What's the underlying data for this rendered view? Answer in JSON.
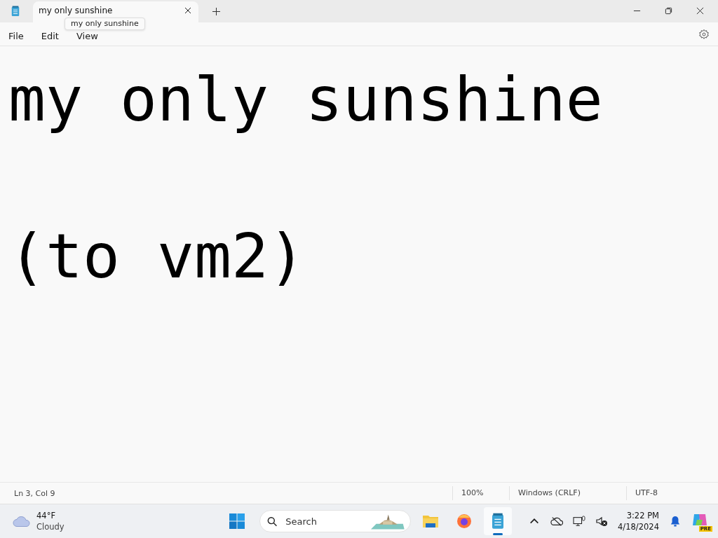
{
  "tabs": [
    {
      "label": "my only sunshine",
      "selected": true
    }
  ],
  "tooltip": "my only sunshine",
  "menu": [
    "File",
    "Edit",
    "View"
  ],
  "editor": {
    "lines": [
      "my only sunshine",
      "(to vm2)"
    ]
  },
  "status_bar": {
    "position": "Ln 3, Col 9",
    "zoom": "100%",
    "line_ending": "Windows (CRLF)",
    "encoding": "UTF-8"
  },
  "taskbar": {
    "weather": {
      "temperature": "44°F",
      "condition": "Cloudy"
    },
    "search": {
      "placeholder": "Search"
    },
    "apps": [
      {
        "kind": "files",
        "selected": false
      },
      {
        "kind": "browser",
        "selected": false
      },
      {
        "kind": "notepad",
        "selected": true
      }
    ],
    "time": "3:22 PM",
    "date": "4/18/2024",
    "badge": "PRE"
  }
}
